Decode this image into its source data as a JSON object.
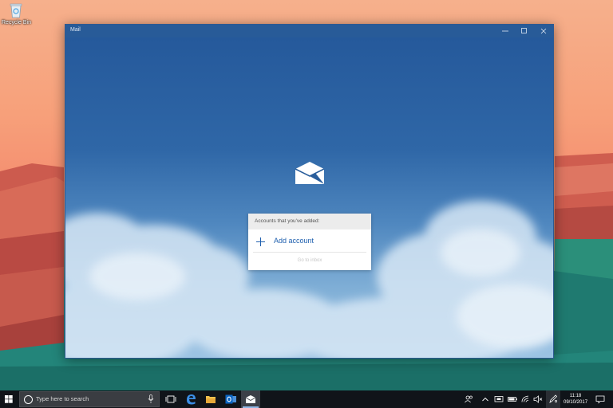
{
  "desktop": {
    "recycle_bin_label": "Recycle Bin"
  },
  "window": {
    "title": "Mail",
    "controls": {
      "minimize_icon": "minimize-icon",
      "maximize_icon": "maximize-icon",
      "close_icon": "close-icon"
    }
  },
  "mail": {
    "logo_icon": "mail-envelope-icon",
    "accounts_header": "Accounts that you've added:",
    "add_account_label": "Add account",
    "add_account_icon": "plus-icon",
    "go_to_inbox_label": "Go to inbox"
  },
  "taskbar": {
    "search_placeholder": "Type here to search",
    "apps": [
      "task-view-icon",
      "edge-icon",
      "file-explorer-icon",
      "outlook-icon",
      "mail-icon"
    ],
    "tray_icons": [
      "people-icon",
      "chevron-up-icon",
      "display-icon",
      "battery-icon",
      "wifi-icon",
      "volume-icon",
      "pen-icon"
    ],
    "time": "11:18",
    "date": "09/10/2017"
  },
  "colors": {
    "title_bar": "#285b98",
    "accent": "#1e5fae",
    "taskbar": "#101419"
  }
}
